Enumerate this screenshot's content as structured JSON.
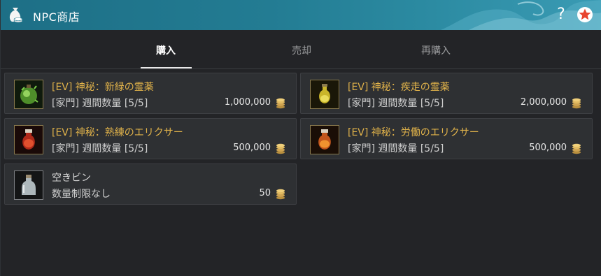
{
  "window": {
    "title": "NPC商店",
    "help_label": "?"
  },
  "tabs": [
    {
      "label": "購入",
      "active": true
    },
    {
      "label": "売却",
      "active": false
    },
    {
      "label": "再購入",
      "active": false
    }
  ],
  "items": [
    {
      "name": "[EV] 神秘：新緑の霊薬",
      "limit": "[家門] 週間数量 [5/5]",
      "price": "1,000,000",
      "icon": "green-elixir-icon"
    },
    {
      "name": "[EV] 神秘：疾走の霊薬",
      "limit": "[家門] 週間数量 [5/5]",
      "price": "2,000,000",
      "icon": "yellow-elixir-icon"
    },
    {
      "name": "[EV] 神秘：熟練のエリクサー",
      "limit": "[家門] 週間数量 [5/5]",
      "price": "500,000",
      "icon": "red-elixir-icon"
    },
    {
      "name": "[EV] 神秘：労働のエリクサー",
      "limit": "[家門] 週間数量 [5/5]",
      "price": "500,000",
      "icon": "orange-elixir-icon"
    },
    {
      "name": "空きビン",
      "limit": "数量制限なし",
      "price": "50",
      "icon": "empty-bottle-icon"
    }
  ],
  "colors": {
    "accent_title": "#237c93",
    "item_name": "#e0b24a",
    "coin": "#d9b15c"
  }
}
